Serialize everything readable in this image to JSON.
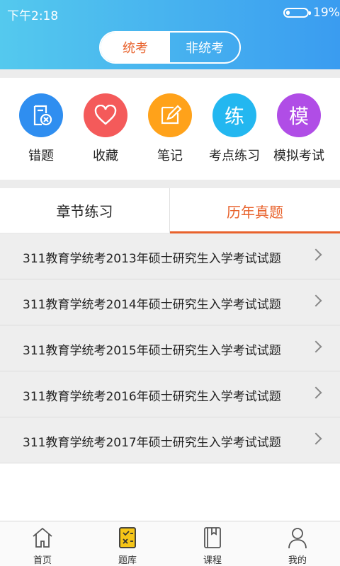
{
  "status_bar": {
    "time": "下午2:18",
    "battery": "19%",
    "battery_level": 0.19
  },
  "segment": {
    "options": [
      "统考",
      "非统考"
    ],
    "selected": "统考"
  },
  "features": [
    {
      "label": "错题",
      "icon": "error-book-icon",
      "color": "#2f8ef0"
    },
    {
      "label": "收藏",
      "icon": "heart-icon",
      "color": "#f45a5a"
    },
    {
      "label": "笔记",
      "icon": "note-edit-icon",
      "color": "#ffa21a"
    },
    {
      "label": "考点练习",
      "icon": "lian-char-icon",
      "glyph": "练",
      "color": "#23b7f0"
    },
    {
      "label": "模拟考试",
      "icon": "mo-char-icon",
      "glyph": "模",
      "color": "#b04de6"
    }
  ],
  "tabs": {
    "items": [
      "章节练习",
      "历年真题"
    ],
    "selected": "历年真题"
  },
  "exams": [
    "311教育学统考2013年硕士研究生入学考试试题",
    "311教育学统考2014年硕士研究生入学考试试题",
    "311教育学统考2015年硕士研究生入学考试试题",
    "311教育学统考2016年硕士研究生入学考试试题",
    "311教育学统考2017年硕士研究生入学考试试题"
  ],
  "bottom_nav": [
    {
      "label": "首页",
      "icon": "home-icon"
    },
    {
      "label": "题库",
      "icon": "question-bank-icon",
      "active": true
    },
    {
      "label": "课程",
      "icon": "course-book-icon"
    },
    {
      "label": "我的",
      "icon": "user-icon"
    }
  ],
  "colors": {
    "accent": "#e8622c",
    "header_start": "#54c9ee",
    "header_end": "#3a9cf0"
  }
}
